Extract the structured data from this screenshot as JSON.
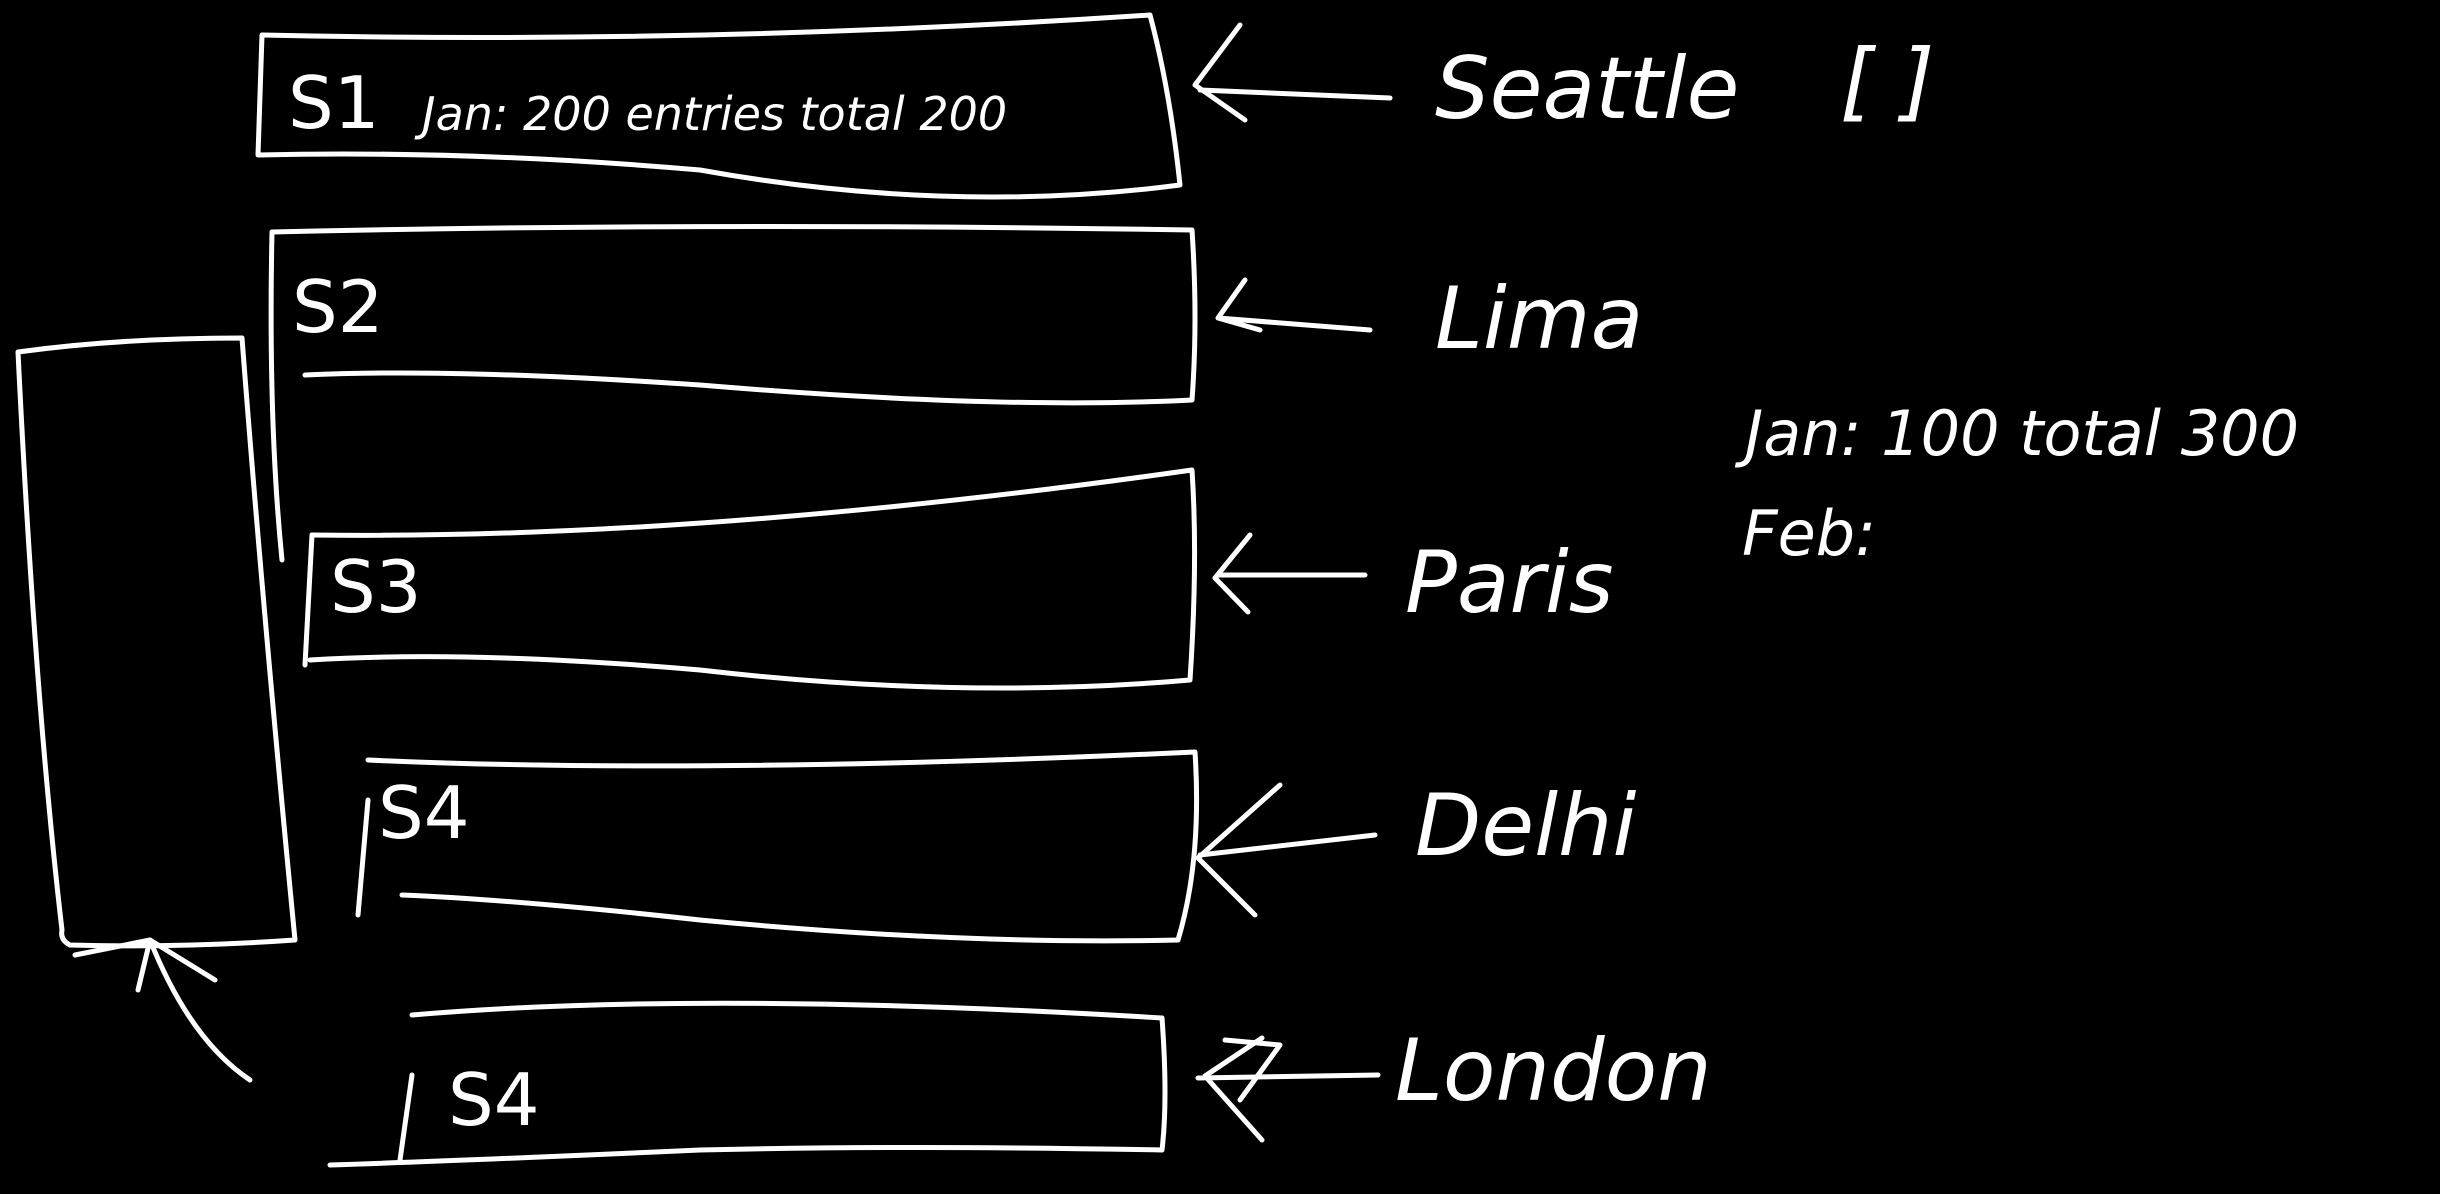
{
  "shards": [
    {
      "label": "S1",
      "note": "Jan:  200 entries   total 200",
      "city": "Seattle"
    },
    {
      "label": "S2",
      "note": "",
      "city": "Lima"
    },
    {
      "label": "S3",
      "note": "",
      "city": "Paris"
    },
    {
      "label": "S4",
      "note": "",
      "city": "Delhi"
    },
    {
      "label": "S4",
      "note": "",
      "city": "London"
    }
  ],
  "seattle_brackets": "[        ]",
  "side_notes": {
    "line1": "Jan: 100   total 300",
    "line2": "Feb:"
  },
  "colors": {
    "background": "#000000",
    "ink": "#ffffff"
  }
}
